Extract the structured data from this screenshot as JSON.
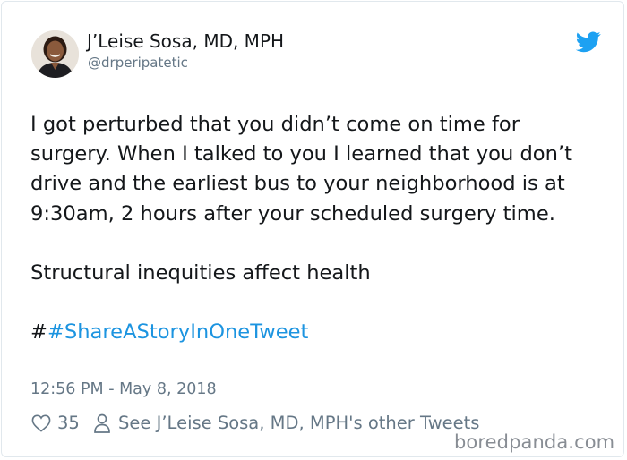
{
  "author": {
    "name": "J’Leise Sosa, MD, MPH",
    "handle": "@drperipatetic",
    "avatar_icon": "profile-photo"
  },
  "brand": {
    "icon": "twitter-bird-icon",
    "color": "#1da1f2"
  },
  "tweet": {
    "paragraph1": "I got perturbed that you didn’t come on time for surgery. When I talked to you I learned that you don’t drive and the earliest bus to your neighborhood is at 9:30am, 2 hours after your scheduled surgery time.",
    "paragraph2": "Structural inequities affect health",
    "hashtag_prefix": "#",
    "hashtag": "#ShareAStoryInOneTweet",
    "hashtag_color": "#1c94e0"
  },
  "timestamp": "12:56 PM - May 8, 2018",
  "actions": {
    "likes": "35",
    "like_icon": "heart-icon",
    "profile_icon": "person-icon",
    "other_tweets_label": "See J’Leise Sosa, MD, MPH's other Tweets"
  },
  "watermark": "boredpanda.com"
}
